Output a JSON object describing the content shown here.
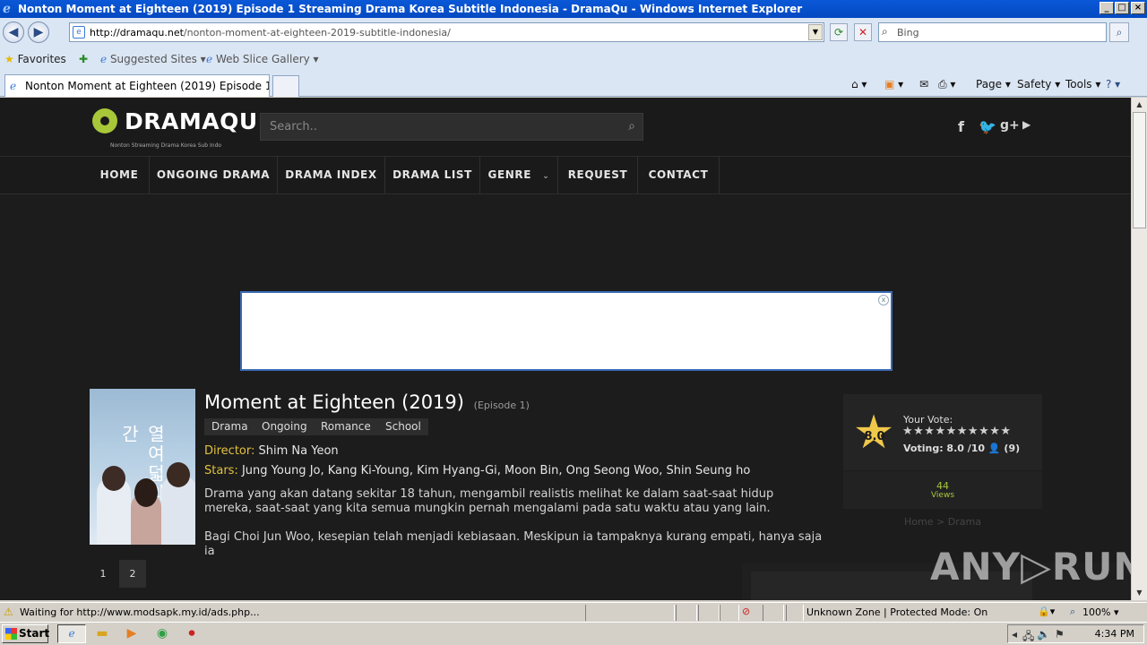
{
  "window": {
    "title": "Nonton Moment at Eighteen (2019) Episode 1 Streaming Drama Korea Subtitle Indonesia - DramaQu - Windows Internet Explorer",
    "controls": [
      "_",
      "□",
      "×"
    ]
  },
  "address_bar": {
    "url_host": "http://dramaqu.net",
    "url_path": "/nonton-moment-at-eighteen-2019-subtitle-indonesia/"
  },
  "search_bar": {
    "placeholder": "Bing"
  },
  "favorites_bar": {
    "favorites_label": "Favorites",
    "items": [
      "Suggested Sites ▾",
      "Web Slice Gallery ▾"
    ]
  },
  "tabs": [
    {
      "label": "Nonton Moment at Eighteen (2019) Episode 1 Streami..."
    }
  ],
  "command_bar": {
    "page": "Page ▾",
    "safety": "Safety ▾",
    "tools": "Tools ▾",
    "help": "? ▾"
  },
  "site": {
    "logo": "DRAMAQU",
    "tagline": "Nonton Streaming Drama Korea Sub Indo",
    "search_placeholder": "Search..",
    "social": [
      "f",
      "t",
      "g+",
      "yt"
    ]
  },
  "nav": [
    {
      "label": "HOME"
    },
    {
      "label": "ONGOING DRAMA"
    },
    {
      "label": "DRAMA INDEX"
    },
    {
      "label": "DRAMA LIST"
    },
    {
      "label": "GENRE"
    },
    {
      "label": "REQUEST"
    },
    {
      "label": "CONTACT"
    }
  ],
  "drama": {
    "title": "Moment at Eighteen (2019)",
    "episode": "(Episode 1)",
    "genres": [
      "Drama",
      "Ongoing",
      "Romance",
      "School"
    ],
    "director_label": "Director:",
    "director": "Shim Na Yeon",
    "stars_label": "Stars:",
    "stars": "Jung Young Jo, Kang Ki-Young, Kim Hyang-Gi, Moon Bin, Ong Seong Woo, Shin Seung ho",
    "desc1": "Drama yang akan datang sekitar 18 tahun, mengambil realistis melihat ke dalam saat-saat hidup mereka, saat-saat yang kita semua mungkin pernah mengalami pada satu waktu atau yang lain.",
    "desc2": "Bagi Choi Jun Woo, kesepian telah menjadi kebiasaan. Meskipun ia tampaknya kurang empati, hanya saja ia",
    "poster_text": "열여덟의 순간"
  },
  "rating": {
    "score": "8.0",
    "your_vote_label": "Your Vote:",
    "voting_text": "Voting: 8.0 /10  👤 (9)",
    "stars": "★★★★★★★★★★",
    "views": "44",
    "views_label": "Views",
    "breadcrumb": "Home > Drama"
  },
  "pagination": [
    "1",
    "2"
  ],
  "watermark": {
    "left": "ANY",
    "right": "RUN"
  },
  "status_bar": {
    "text": "Waiting for http://www.modsapk.my.id/ads.php...",
    "zone": "Unknown Zone | Protected Mode: On",
    "zoom": "100% ▾"
  },
  "taskbar": {
    "start": "Start",
    "clock": "4:34 PM"
  }
}
